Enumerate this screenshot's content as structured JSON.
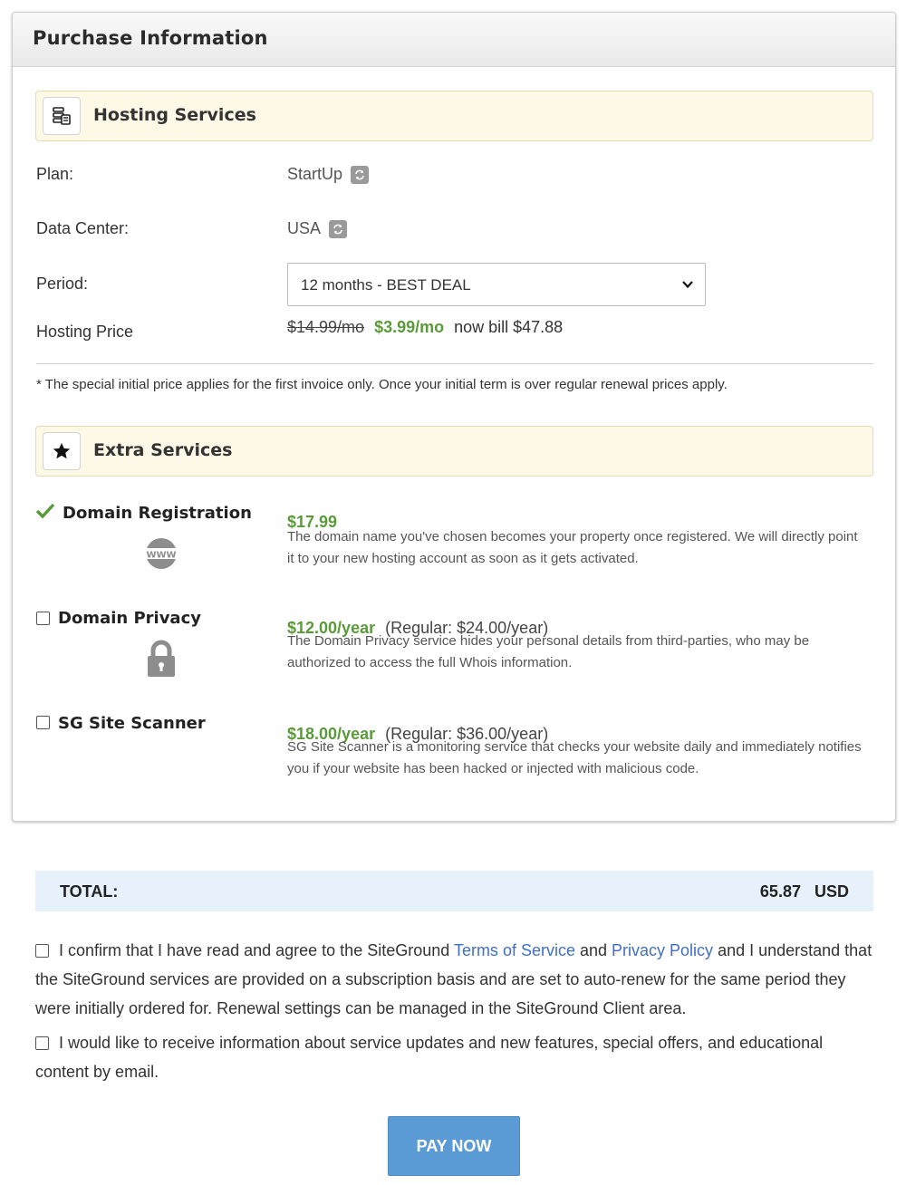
{
  "panel_title": "Purchase Information",
  "hosting": {
    "section_title": "Hosting Services",
    "icon": "server-icon",
    "plan_label": "Plan:",
    "plan_value": "StartUp",
    "datacenter_label": "Data Center:",
    "datacenter_value": "USA",
    "period_label": "Period:",
    "period_selected": "12 months - BEST DEAL",
    "price_label": "Hosting Price",
    "old_price": "$14.99/mo",
    "new_price": "$3.99/mo",
    "bill_text": "now bill $47.88",
    "note": "* The special initial price applies for the first invoice only. Once your initial term is over regular renewal prices apply."
  },
  "extras": {
    "section_title": "Extra Services",
    "icon": "star-icon",
    "items": [
      {
        "name": "Domain Registration",
        "checked": true,
        "icon": "www-globe-icon",
        "price": "$17.99",
        "regular": "",
        "description": "The domain name you've chosen becomes your property once registered. We will directly point it to your new hosting account as soon as it gets activated."
      },
      {
        "name": "Domain Privacy",
        "checked": false,
        "icon": "padlock-icon",
        "price": "$12.00/year",
        "regular": "(Regular: $24.00/year)",
        "description": "The Domain Privacy service hides your personal details from third-parties, who may be authorized to access the full Whois information."
      },
      {
        "name": "SG Site Scanner",
        "checked": false,
        "icon": "",
        "price": "$18.00/year",
        "regular": "(Regular: $36.00/year)",
        "description": "SG Site Scanner is a monitoring service that checks your website daily and immediately notifies you if your website has been hacked or injected with malicious code."
      }
    ]
  },
  "total": {
    "label": "TOTAL:",
    "value": "65.87",
    "currency": "USD"
  },
  "agreements": {
    "tos_part1": "I confirm that I have read and agree to the SiteGround ",
    "tos_link": "Terms of Service",
    "tos_part2": " and ",
    "privacy_link": "Privacy Policy",
    "tos_part3": " and I understand that the SiteGround services are provided on a subscription basis and are set to auto-renew for the same period they were initially ordered for. Renewal settings can be managed in the SiteGround Client area.",
    "newsletter": "I would like to receive information about service updates and new features, special offers, and educational content by email."
  },
  "pay_button": "PAY NOW",
  "colors": {
    "accent_green": "#5b9a3a",
    "link_blue": "#3f6fc5",
    "button_blue": "#5b9bd5",
    "section_bar": "#fdf9e6",
    "total_bar": "#e6f1fc"
  }
}
